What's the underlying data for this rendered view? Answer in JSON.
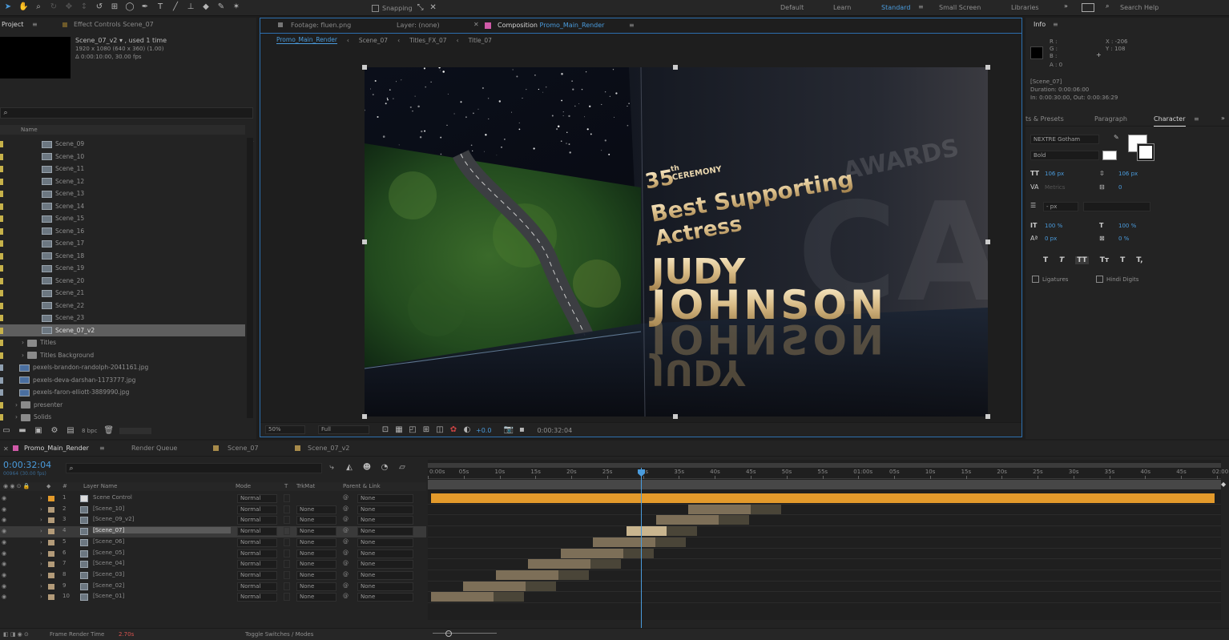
{
  "toolbar": {
    "snapping_label": "Snapping",
    "workspaces": [
      "Default",
      "Learn",
      "Standard",
      "Small Screen",
      "Libraries"
    ],
    "active_workspace": "Standard",
    "search_placeholder": "Search Help"
  },
  "project_panel": {
    "tab_project": "Project",
    "tab_effect_controls": "Effect Controls Scene_07",
    "selected_name": "Scene_07_v2 ▾ , used 1 time",
    "selected_info_1": "1920 x 1080 (640 x 360) (1.00)",
    "selected_info_2": "Δ 0:00:10:00, 30.00 fps",
    "column_name": "Name",
    "items": [
      {
        "name": "Scene_09",
        "kind": "comp"
      },
      {
        "name": "Scene_10",
        "kind": "comp"
      },
      {
        "name": "Scene_11",
        "kind": "comp"
      },
      {
        "name": "Scene_12",
        "kind": "comp"
      },
      {
        "name": "Scene_13",
        "kind": "comp"
      },
      {
        "name": "Scene_14",
        "kind": "comp"
      },
      {
        "name": "Scene_15",
        "kind": "comp"
      },
      {
        "name": "Scene_16",
        "kind": "comp"
      },
      {
        "name": "Scene_17",
        "kind": "comp"
      },
      {
        "name": "Scene_18",
        "kind": "comp"
      },
      {
        "name": "Scene_19",
        "kind": "comp"
      },
      {
        "name": "Scene_20",
        "kind": "comp"
      },
      {
        "name": "Scene_21",
        "kind": "comp"
      },
      {
        "name": "Scene_22",
        "kind": "comp"
      },
      {
        "name": "Scene_23",
        "kind": "comp"
      },
      {
        "name": "Scene_07_v2",
        "kind": "comp",
        "selected": true
      },
      {
        "name": "Titles",
        "kind": "folder"
      },
      {
        "name": "Titles Background",
        "kind": "folder"
      },
      {
        "name": "pexels-brandon-randolph-2041161.jpg",
        "kind": "image"
      },
      {
        "name": "pexels-deva-darshan-1173777.jpg",
        "kind": "image"
      },
      {
        "name": "pexels-faron-elliott-3889990.jpg",
        "kind": "image"
      },
      {
        "name": "presenter",
        "kind": "folder"
      },
      {
        "name": "Solids",
        "kind": "folder"
      }
    ],
    "bpc_label": "8 bpc"
  },
  "comp_panel": {
    "tab_footage": "Footage: fluen.png",
    "tab_layer": "Layer: (none)",
    "tab_comp_prefix": "Composition",
    "tab_comp_name": "Promo_Main_Render",
    "breadcrumbs": [
      "Promo_Main_Render",
      "Scene_07",
      "Titles_FX_07",
      "Title_07"
    ],
    "zoom": "50%",
    "resolution": "Full",
    "exposure": "+0.0",
    "timecode": "0:00:32:04"
  },
  "artwork": {
    "ordinal": "35",
    "ordinal_suffix": "th",
    "ceremony": "CEREMONY",
    "category_line1": "Best Supporting",
    "category_line2": "Actress",
    "name_first": "JUDY",
    "name_last": "JOHNSON",
    "bg_word": "AWARDS"
  },
  "info_panel": {
    "title": "Info",
    "r": "R :",
    "g": "G :",
    "b": "B :",
    "a": "A : 0",
    "x": "X : -206",
    "y": "Y : 108",
    "layer_name": "[Scene_07]",
    "duration": "Duration: 0:00:06:00",
    "in_out": "In: 0:00:30:00, Out: 0:00:36:29"
  },
  "character_panel": {
    "tab_presets": "ts & Presets",
    "tab_paragraph": "Paragraph",
    "tab_character": "Character",
    "font_family": "NEXTRE Gotham",
    "font_style": "Bold",
    "font_size": "106 px",
    "leading": "106 px",
    "kerning": "Metrics",
    "tracking": "0",
    "stroke": "- px",
    "vert_scale": "100 %",
    "horiz_scale": "100 %",
    "baseline": "0 px",
    "tsume": "0 %",
    "style_buttons": [
      "T",
      "T",
      "TT",
      "Tт",
      "T",
      "T,"
    ],
    "ligatures": "Ligatures",
    "hindi_digits": "Hindi Digits"
  },
  "timeline": {
    "tab_main": "Promo_Main_Render",
    "tab_render_queue": "Render Queue",
    "tab_scene07": "Scene_07",
    "tab_scene07v2": "Scene_07_v2",
    "current_time": "0:00:32:04",
    "frame_info": "00964 (30.00 fps)",
    "col_layer_name": "Layer Name",
    "col_mode": "Mode",
    "col_t": "T",
    "col_trkmat": "TrkMat",
    "col_parent": "Parent & Link",
    "ruler_labels": [
      "0:00s",
      "05s",
      "10s",
      "15s",
      "20s",
      "25s",
      "30s",
      "35s",
      "40s",
      "45s",
      "50s",
      "55s",
      "01:00s",
      "05s",
      "10s",
      "15s",
      "20s",
      "25s",
      "30s",
      "35s",
      "40s",
      "45s",
      "02:00"
    ],
    "layers": [
      {
        "num": "1",
        "name": "Scene Control",
        "mode": "Normal",
        "trkmat": "",
        "parent": "None",
        "color": "#e39a2b"
      },
      {
        "num": "2",
        "name": "[Scene_10]",
        "mode": "Normal",
        "trkmat": "None",
        "parent": "None",
        "color": "#b39b79"
      },
      {
        "num": "3",
        "name": "[Scene_09_v2]",
        "mode": "Normal",
        "trkmat": "None",
        "parent": "None",
        "color": "#b39b79"
      },
      {
        "num": "4",
        "name": "[Scene_07]",
        "mode": "Normal",
        "trkmat": "None",
        "parent": "None",
        "color": "#b39b79",
        "selected": true
      },
      {
        "num": "5",
        "name": "[Scene_06]",
        "mode": "Normal",
        "trkmat": "None",
        "parent": "None",
        "color": "#b39b79"
      },
      {
        "num": "6",
        "name": "[Scene_05]",
        "mode": "Normal",
        "trkmat": "None",
        "parent": "None",
        "color": "#b39b79"
      },
      {
        "num": "7",
        "name": "[Scene_04]",
        "mode": "Normal",
        "trkmat": "None",
        "parent": "None",
        "color": "#b39b79"
      },
      {
        "num": "8",
        "name": "[Scene_03]",
        "mode": "Normal",
        "trkmat": "None",
        "parent": "None",
        "color": "#b39b79"
      },
      {
        "num": "9",
        "name": "[Scene_02]",
        "mode": "Normal",
        "trkmat": "None",
        "parent": "None",
        "color": "#b39b79"
      },
      {
        "num": "10",
        "name": "[Scene_01]",
        "mode": "Normal",
        "trkmat": "None",
        "parent": "None",
        "color": "#b39b79"
      }
    ],
    "frame_render_label": "Frame Render Time",
    "frame_render_value": "2.70s",
    "toggle_label": "Toggle Switches / Modes"
  }
}
